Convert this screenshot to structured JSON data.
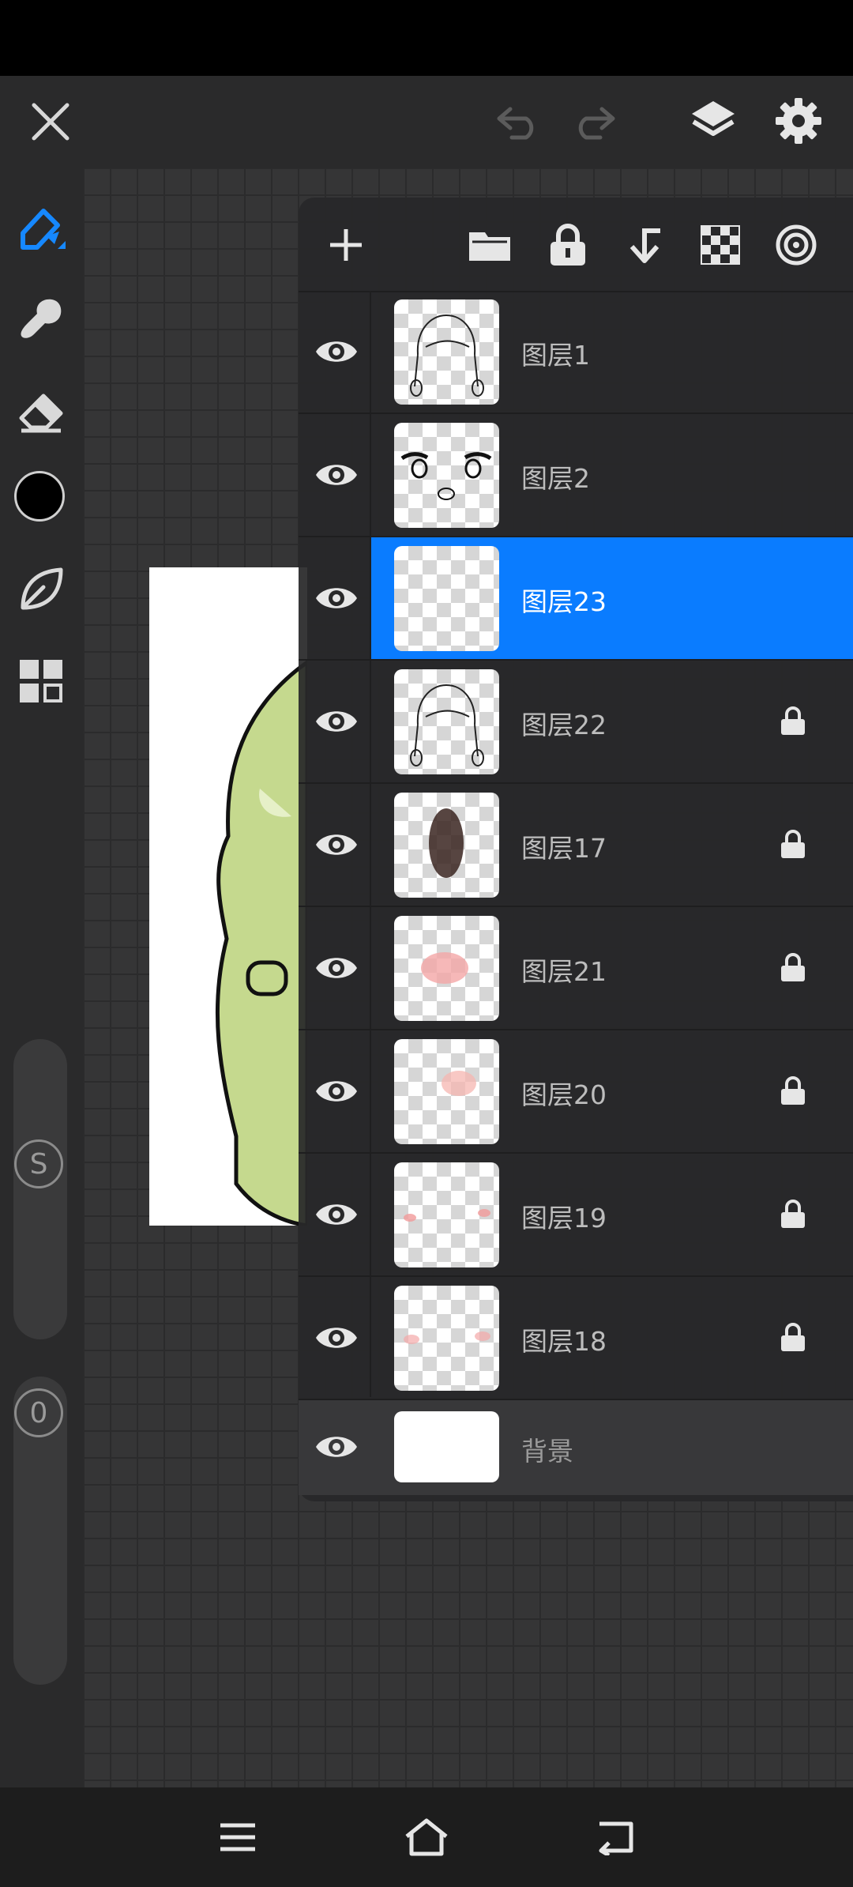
{
  "toolbar": {
    "close": "close-icon",
    "undo": "undo-icon",
    "redo": "redo-icon",
    "layers": "layers-icon",
    "settings": "gear-icon"
  },
  "tools": [
    "pen-tool-icon",
    "smudge-brush-icon",
    "eraser-icon",
    "color-swatch",
    "leaf-brush-icon",
    "grid-menu-icon"
  ],
  "sliders": {
    "size_label": "S",
    "opacity_label": "0"
  },
  "layer_toolbar": [
    "add-layer-icon",
    "folder-icon",
    "lock-icon",
    "merge-down-icon",
    "transparency-icon",
    "blend-mode-icon"
  ],
  "layers": [
    {
      "name": "图层1",
      "locked": false,
      "selected": false
    },
    {
      "name": "图层2",
      "locked": false,
      "selected": false
    },
    {
      "name": "图层23",
      "locked": false,
      "selected": true
    },
    {
      "name": "图层22",
      "locked": true,
      "selected": false
    },
    {
      "name": "图层17",
      "locked": true,
      "selected": false
    },
    {
      "name": "图层21",
      "locked": true,
      "selected": false
    },
    {
      "name": "图层20",
      "locked": true,
      "selected": false
    },
    {
      "name": "图层19",
      "locked": true,
      "selected": false
    },
    {
      "name": "图层18",
      "locked": true,
      "selected": false
    }
  ],
  "background_layer": {
    "name": "背景"
  },
  "colors": {
    "accent": "#0a7cff",
    "current_color": "#000000"
  },
  "nav": [
    "menu-icon",
    "home-icon",
    "back-icon"
  ]
}
